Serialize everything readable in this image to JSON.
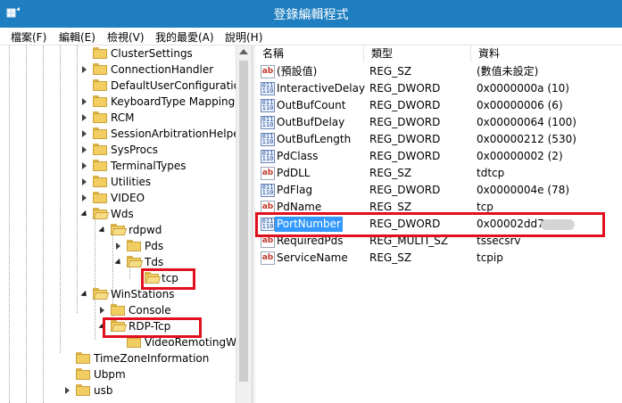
{
  "window": {
    "title": "登錄編輯程式"
  },
  "menu": [
    "檔案(F)",
    "編輯(E)",
    "檢視(V)",
    "我的最愛(A)",
    "說明(H)"
  ],
  "tree": [
    {
      "label": "ClusterSettings",
      "expander": "none"
    },
    {
      "label": "ConnectionHandler",
      "expander": "collapsed"
    },
    {
      "label": "DefaultUserConfiguration",
      "expander": "none"
    },
    {
      "label": "KeyboardType Mapping",
      "expander": "collapsed"
    },
    {
      "label": "RCM",
      "expander": "collapsed"
    },
    {
      "label": "SessionArbitrationHelper",
      "expander": "collapsed"
    },
    {
      "label": "SysProcs",
      "expander": "collapsed"
    },
    {
      "label": "TerminalTypes",
      "expander": "collapsed"
    },
    {
      "label": "Utilities",
      "expander": "collapsed"
    },
    {
      "label": "VIDEO",
      "expander": "collapsed"
    },
    {
      "label": "Wds",
      "expander": "expanded"
    },
    {
      "label": "rdpwd",
      "expander": "expanded"
    },
    {
      "label": "Pds",
      "expander": "collapsed"
    },
    {
      "label": "Tds",
      "expander": "expanded"
    },
    {
      "label": "tcp",
      "expander": "none"
    },
    {
      "label": "WinStations",
      "expander": "expanded"
    },
    {
      "label": "Console",
      "expander": "collapsed"
    },
    {
      "label": "RDP-Tcp",
      "expander": "expanded"
    },
    {
      "label": "VideoRemotingWindowNames",
      "expander": "none"
    },
    {
      "label": "TimeZoneInformation",
      "expander": "none"
    },
    {
      "label": "Ubpm",
      "expander": "none"
    },
    {
      "label": "usb",
      "expander": "collapsed"
    }
  ],
  "columns": {
    "name": "名稱",
    "type": "類型",
    "data": "資料"
  },
  "values": [
    {
      "icon": "string-value-icon",
      "name": "(預設值)",
      "type": "REG_SZ",
      "data": "(數值未設定)"
    },
    {
      "icon": "dword-value-icon",
      "name": "InteractiveDelay",
      "type": "REG_DWORD",
      "data": "0x0000000a (10)"
    },
    {
      "icon": "dword-value-icon",
      "name": "OutBufCount",
      "type": "REG_DWORD",
      "data": "0x00000006 (6)"
    },
    {
      "icon": "dword-value-icon",
      "name": "OutBufDelay",
      "type": "REG_DWORD",
      "data": "0x00000064 (100)"
    },
    {
      "icon": "dword-value-icon",
      "name": "OutBufLength",
      "type": "REG_DWORD",
      "data": "0x00000212 (530)"
    },
    {
      "icon": "dword-value-icon",
      "name": "PdClass",
      "type": "REG_DWORD",
      "data": "0x00000002 (2)"
    },
    {
      "icon": "string-value-icon",
      "name": "PdDLL",
      "type": "REG_SZ",
      "data": "tdtcp"
    },
    {
      "icon": "dword-value-icon",
      "name": "PdFlag",
      "type": "REG_DWORD",
      "data": "0x0000004e (78)"
    },
    {
      "icon": "string-value-icon",
      "name": "PdName",
      "type": "REG_SZ",
      "data": "tcp"
    },
    {
      "icon": "dword-value-icon",
      "name": "PortNumber",
      "type": "REG_DWORD",
      "data": "0x00002dd7"
    },
    {
      "icon": "string-value-icon",
      "name": "RequiredPds",
      "type": "REG_MULTI_SZ",
      "data": "tssecsrv"
    },
    {
      "icon": "string-value-icon",
      "name": "ServiceName",
      "type": "REG_SZ",
      "data": "tcpip"
    }
  ],
  "colors": {
    "titlebar": "#1e7ec0",
    "selection": "#3399ff",
    "highlight_box": "#e0101c"
  }
}
